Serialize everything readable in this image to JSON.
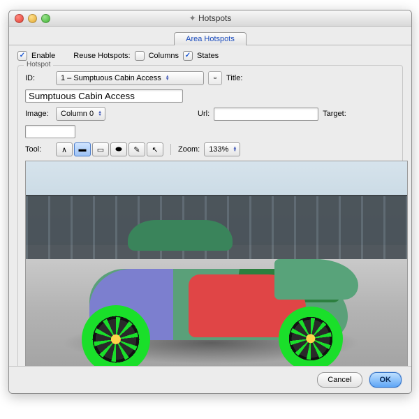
{
  "window": {
    "title": "Hotspots"
  },
  "tabs": {
    "active": "Area Hotspots"
  },
  "options": {
    "enable_label": "Enable",
    "enable_checked": true,
    "reuse_label": "Reuse Hotspots:",
    "columns_label": "Columns",
    "columns_checked": false,
    "states_label": "States",
    "states_checked": true
  },
  "hotspot": {
    "legend": "Hotspot",
    "id_label": "ID:",
    "id_value": "1 – Sumptuous Cabin Access",
    "new_icon": "new-hotspot-icon",
    "title_label": "Title:",
    "title_value": "Sumptuous Cabin Access",
    "image_label": "Image:",
    "image_value": "Column 0",
    "url_label": "Url:",
    "url_value": "",
    "target_label": "Target:",
    "target_value": "",
    "tool_label": "Tool:",
    "zoom_label": "Zoom:",
    "zoom_value": "133%",
    "tools": [
      {
        "name": "polyline-tool-icon",
        "glyph": "∧",
        "selected": false
      },
      {
        "name": "rect-tool-icon",
        "glyph": "▬",
        "selected": true
      },
      {
        "name": "roundrect-tool-icon",
        "glyph": "▭",
        "selected": false
      },
      {
        "name": "ellipse-tool-icon",
        "glyph": "⬬",
        "selected": false
      },
      {
        "name": "freehand-tool-icon",
        "glyph": "✎",
        "selected": false
      },
      {
        "name": "pointer-tool-icon",
        "glyph": "↖",
        "selected": false
      }
    ]
  },
  "footer": {
    "cancel": "Cancel",
    "ok": "OK"
  }
}
